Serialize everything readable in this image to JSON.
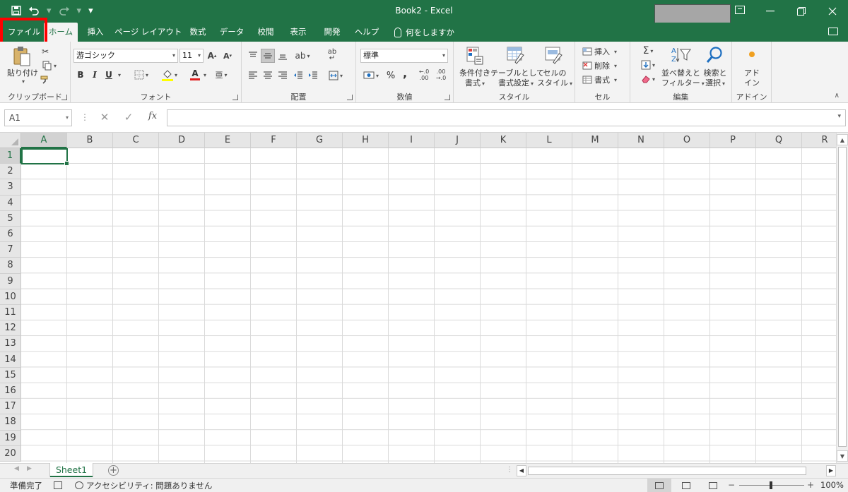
{
  "window": {
    "title": "Book2  -  Excel",
    "icons": [
      "save-icon",
      "undo-icon",
      "redo-icon",
      "customize-qat-icon",
      "ribbon-display-options-icon",
      "minimize-icon",
      "restore-icon",
      "close-icon"
    ]
  },
  "tabs": {
    "file": "ファイル",
    "home": "ホーム",
    "insert": "挿入",
    "page_layout": "ページ レイアウト",
    "formulas": "数式",
    "data": "データ",
    "review": "校閲",
    "view": "表示",
    "developer": "開発",
    "help": "ヘルプ",
    "tell_me": "何をしますか"
  },
  "ribbon": {
    "clipboard": {
      "label": "クリップボード",
      "paste": "貼り付け"
    },
    "font": {
      "label": "フォント",
      "font_name": "游ゴシック",
      "font_size": "11",
      "bold": "B",
      "italic": "I",
      "underline": "U",
      "font_color_letter": "A"
    },
    "alignment": {
      "label": "配置"
    },
    "number": {
      "label": "数値",
      "format": "標準",
      "percent": "%",
      "comma": ","
    },
    "styles": {
      "label": "スタイル",
      "conditional_line1": "条件付き",
      "conditional_line2": "書式",
      "table_line1": "テーブルとして",
      "table_line2": "書式設定",
      "cell_styles_line1": "セルの",
      "cell_styles_line2": "スタイル"
    },
    "cells": {
      "label": "セル",
      "insert": "挿入",
      "delete": "削除",
      "format": "書式"
    },
    "editing": {
      "label": "編集",
      "sort_line1": "並べ替えと",
      "sort_line2": "フィルター",
      "find_line1": "検索と",
      "find_line2": "選択"
    },
    "addins": {
      "label": "アドイン",
      "line1": "アド",
      "line2": "イン"
    }
  },
  "formula_bar": {
    "name_box": "A1",
    "fx": "fx",
    "value": ""
  },
  "grid": {
    "columns": [
      "A",
      "B",
      "C",
      "D",
      "E",
      "F",
      "G",
      "H",
      "I",
      "J",
      "K",
      "L",
      "M",
      "N",
      "O",
      "P",
      "Q",
      "R"
    ],
    "rows": [
      "1",
      "2",
      "3",
      "4",
      "5",
      "6",
      "7",
      "8",
      "9",
      "10",
      "11",
      "12",
      "13",
      "14",
      "15",
      "16",
      "17",
      "18",
      "19",
      "20"
    ],
    "active_cell": "A1"
  },
  "sheets": [
    "Sheet1"
  ],
  "status": {
    "ready": "準備完了",
    "accessibility": "アクセシビリティ: 問題ありません",
    "zoom": "100%"
  },
  "colors": {
    "excel_green": "#217346",
    "highlight_red": "#ff0000"
  }
}
